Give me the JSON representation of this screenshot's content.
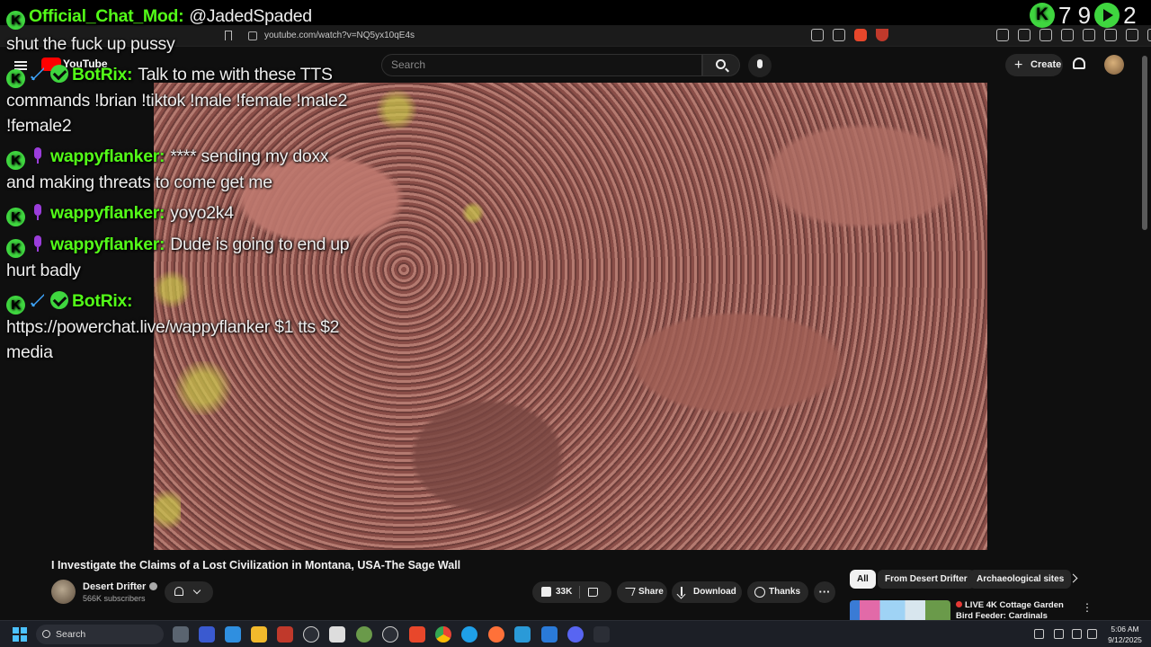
{
  "browser": {
    "url": "youtube.com/watch?v=NQ5yx10qE4s"
  },
  "youtube": {
    "logo_text": "YouTube",
    "search_placeholder": "Search",
    "create_label": "Create"
  },
  "video": {
    "title": "I Investigate the Claims of a Lost Civilization in Montana, USA-The Sage Wall",
    "channel_name": "Desert Drifter",
    "subscribers": "566K subscribers",
    "likes": "33K",
    "share_label": "Share",
    "download_label": "Download",
    "thanks_label": "Thanks",
    "more_label": "···"
  },
  "chips": [
    "All",
    "From Desert Drifter",
    "Archaeological sites"
  ],
  "recommendation": {
    "title": "LIVE 4K Cottage Garden Bird Feeder: Cardinals"
  },
  "stats": {
    "k_icon": "K",
    "first": "7 9",
    "second": "2"
  },
  "chat": [
    {
      "badges": [
        "k"
      ],
      "user": "Official_Chat_Mod:",
      "text": "@JadedSpaded"
    },
    {
      "badges": [],
      "user": "",
      "text": "shut the fuck up pussy"
    },
    {
      "badges": [
        "k",
        "sword",
        "check"
      ],
      "user": "BotRix:",
      "text": "Talk to me with these TTS commands !brian !tiktok !male !female !male2 !female2"
    },
    {
      "badges": [
        "k",
        "mic"
      ],
      "user": "wappyflanker:",
      "text": "**** sending my doxx and making threats to come get me"
    },
    {
      "badges": [
        "k",
        "mic"
      ],
      "user": "wappyflanker:",
      "text": "yoyo2k4"
    },
    {
      "badges": [
        "k",
        "mic"
      ],
      "user": "wappyflanker:",
      "text": "Dude is going to end up hurt badly"
    },
    {
      "badges": [
        "k",
        "sword",
        "check"
      ],
      "user": "BotRix:",
      "text": "https://powerchat.live/wappyflanker $1 tts $2 media"
    }
  ],
  "taskbar": {
    "search_label": "Search",
    "time": "5:06 AM",
    "date": "9/12/2025"
  },
  "icons": {
    "k_badge": "kick-k-icon",
    "sword": "sword-badge-icon",
    "check": "verified-check-icon",
    "mic": "mic-badge-icon"
  }
}
